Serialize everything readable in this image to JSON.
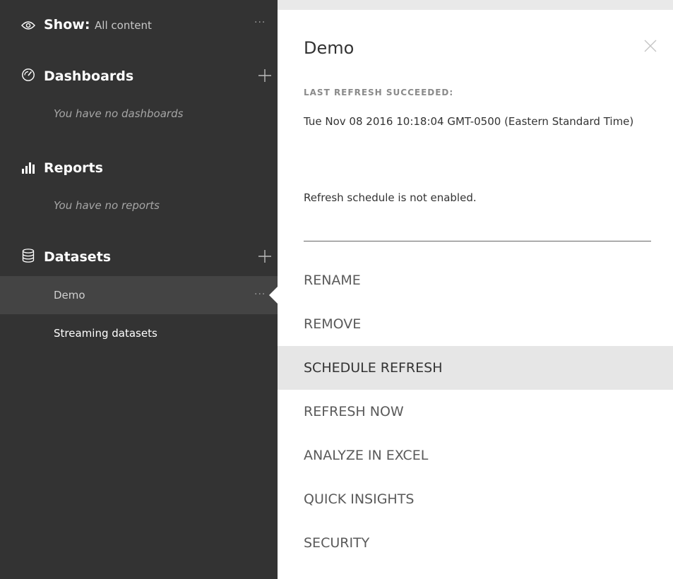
{
  "sidebar": {
    "show": {
      "label": "Show:",
      "value": "All content",
      "icon": "eye-icon"
    },
    "dashboards": {
      "heading": "Dashboards",
      "icon": "gauge-icon",
      "empty": "You have no dashboards"
    },
    "reports": {
      "heading": "Reports",
      "icon": "bar-chart-icon",
      "empty": "You have no reports"
    },
    "datasets": {
      "heading": "Datasets",
      "icon": "database-icon",
      "items": [
        {
          "label": "Demo",
          "selected": true
        },
        {
          "label": "Streaming datasets",
          "selected": false
        }
      ]
    }
  },
  "panel": {
    "title": "Demo",
    "last_refresh_label": "LAST REFRESH SUCCEEDED:",
    "last_refresh_time": "Tue Nov 08 2016 10:18:04 GMT-0500 (Eastern Standard Time)",
    "schedule_note": "Refresh schedule is not enabled.",
    "menu": [
      {
        "label": "RENAME",
        "active": false
      },
      {
        "label": "REMOVE",
        "active": false
      },
      {
        "label": "SCHEDULE REFRESH",
        "active": true
      },
      {
        "label": "REFRESH NOW",
        "active": false
      },
      {
        "label": "ANALYZE IN EXCEL",
        "active": false
      },
      {
        "label": "QUICK INSIGHTS",
        "active": false
      },
      {
        "label": "SECURITY",
        "active": false
      }
    ]
  },
  "colors": {
    "sidebar_bg": "#333333",
    "sidebar_selected_bg": "#444444",
    "panel_bg": "#ffffff",
    "menu_active_bg": "#e6e6e6"
  }
}
